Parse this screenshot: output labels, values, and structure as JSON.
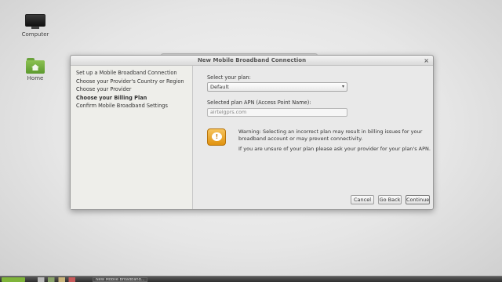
{
  "desktop": {
    "icons": [
      {
        "label": "Computer"
      },
      {
        "label": "Home"
      }
    ]
  },
  "dialog": {
    "title": "New Mobile Broadband Connection",
    "close_glyph": "×",
    "steps": [
      {
        "label": "Set up a Mobile Broadband Connection",
        "active": false
      },
      {
        "label": "Choose your Provider's Country or Region",
        "active": false
      },
      {
        "label": "Choose your Provider",
        "active": false
      },
      {
        "label": "Choose your Billing Plan",
        "active": true
      },
      {
        "label": "Confirm Mobile Broadband Settings",
        "active": false
      }
    ],
    "plan_label": "Select your plan:",
    "plan_value": "Default",
    "apn_label": "Selected plan APN (Access Point Name):",
    "apn_value": "airtelgprs.com",
    "warning_text": "Warning: Selecting an incorrect plan may result in billing issues for your broadband account or may prevent connectivity.",
    "unsure_text": "If you are unsure of your plan please ask your provider for your plan's APN.",
    "buttons": {
      "cancel": "Cancel",
      "back": "Go Back",
      "continue": "Continue"
    },
    "warning_color": "#e8a324"
  },
  "taskbar": {
    "window_label": "New Mobile Broadband..."
  }
}
